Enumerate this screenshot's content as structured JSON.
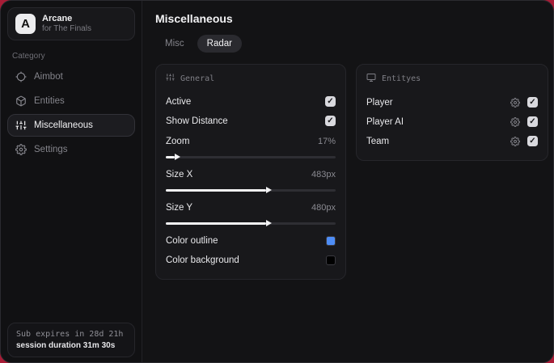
{
  "window": {
    "accent_bg": "#a81c36"
  },
  "sidebar": {
    "brand": {
      "initial": "A",
      "title": "Arcane",
      "subtitle": "for The Finals"
    },
    "category_label": "Category",
    "items": [
      {
        "label": "Aimbot",
        "icon": "crosshair-icon",
        "selected": false
      },
      {
        "label": "Entities",
        "icon": "cube-icon",
        "selected": false
      },
      {
        "label": "Miscellaneous",
        "icon": "sliders-icon",
        "selected": true
      },
      {
        "label": "Settings",
        "icon": "gear-icon",
        "selected": false
      }
    ],
    "footer": {
      "sub_expires": "Sub expires in 28d 21h",
      "session_duration": "session duration 31m 30s"
    }
  },
  "main": {
    "title": "Miscellaneous",
    "tabs": [
      {
        "label": "Misc",
        "active": false
      },
      {
        "label": "Radar",
        "active": true
      }
    ],
    "general_panel": {
      "title": "General",
      "toggles": [
        {
          "label": "Active",
          "checked": true
        },
        {
          "label": "Show Distance",
          "checked": true
        }
      ],
      "sliders": [
        {
          "label": "Zoom",
          "value": "17%",
          "fill_percent": 5
        },
        {
          "label": "Size X",
          "value": "483px",
          "fill_percent": 59
        },
        {
          "label": "Size Y",
          "value": "480px",
          "fill_percent": 59
        }
      ],
      "colors": [
        {
          "label": "Color outline",
          "swatch": "#4e8df6"
        },
        {
          "label": "Color background",
          "swatch": "#000000"
        }
      ]
    },
    "entities_panel": {
      "title": "Entityes",
      "rows": [
        {
          "label": "Player",
          "checked": true
        },
        {
          "label": "Player AI",
          "checked": true
        },
        {
          "label": "Team",
          "checked": true
        }
      ]
    }
  }
}
